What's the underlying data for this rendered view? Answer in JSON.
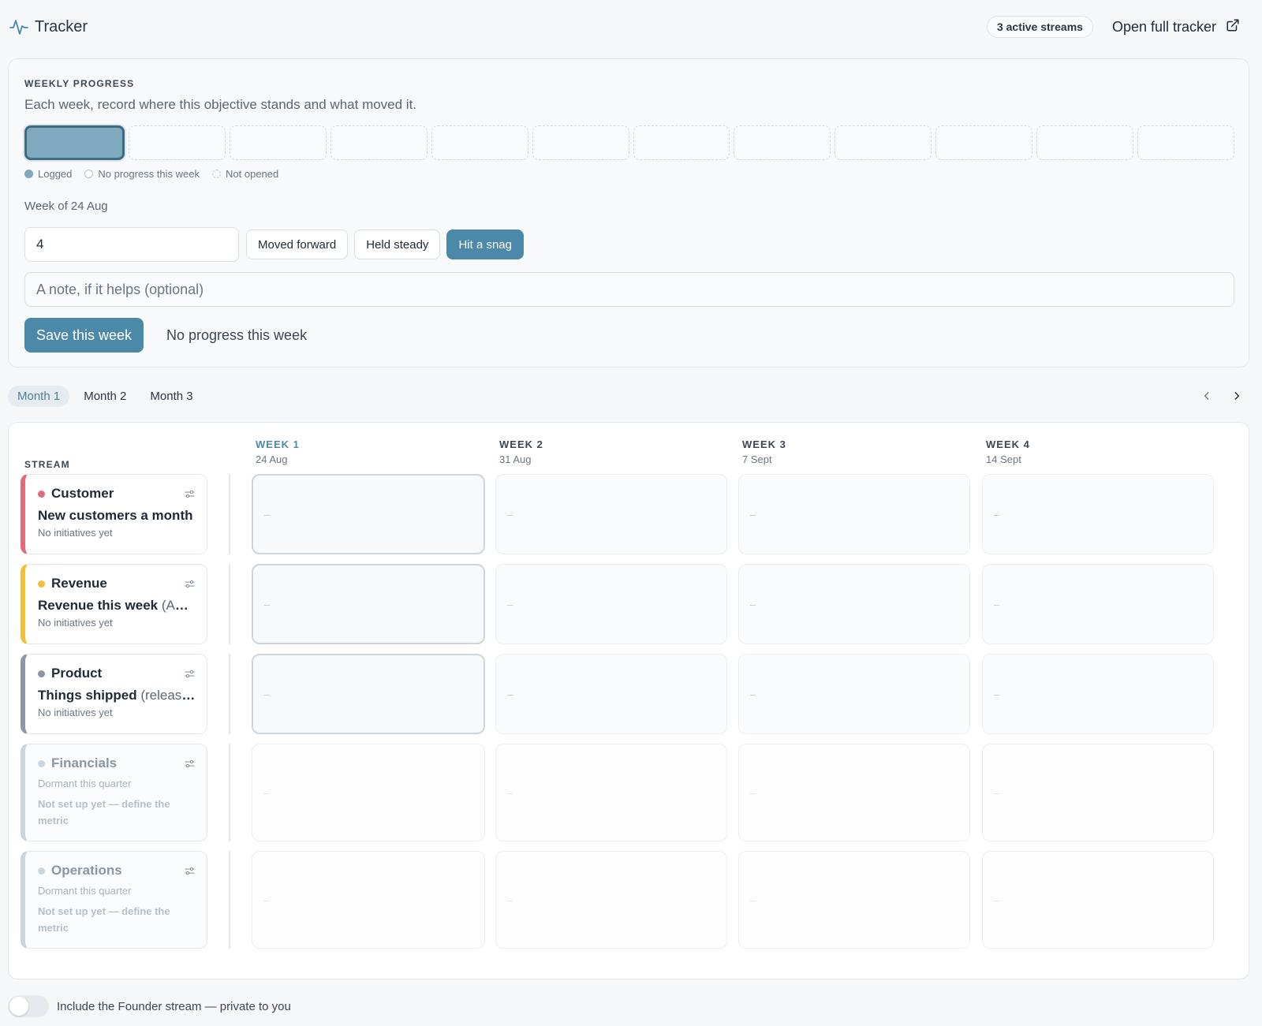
{
  "header": {
    "icon": "activity-pulse-icon",
    "title": "Tracker",
    "badge": "3 active streams",
    "open_label": "Open full tracker",
    "open_icon": "external-link-icon"
  },
  "progress": {
    "section_label": "WEEKLY PROGRESS",
    "description": "Each week, record where this objective stands and what moved it.",
    "week_states": [
      "logged",
      "not-opened",
      "not-opened",
      "not-opened",
      "not-opened",
      "not-opened",
      "not-opened",
      "not-opened",
      "not-opened",
      "not-opened",
      "not-opened",
      "not-opened"
    ],
    "legend": {
      "logged": "Logged",
      "no_progress": "No progress this week",
      "not_opened": "Not opened"
    },
    "week_of": "Week of 24 Aug",
    "value": "4",
    "status_options": [
      "Moved forward",
      "Held steady",
      "Hit a snag"
    ],
    "selected_status": "Hit a snag",
    "note_placeholder": "A note, if it helps (optional)",
    "save_label": "Save this week",
    "no_progress_label": "No progress this week",
    "accent_color": "#4c88a8"
  },
  "months": {
    "tabs": [
      "Month 1",
      "Month 2",
      "Month 3"
    ],
    "active": "Month 1"
  },
  "grid": {
    "stream_header": "STREAM",
    "weeks": [
      {
        "label": "WEEK 1",
        "date": "24 Aug",
        "current": true
      },
      {
        "label": "WEEK 2",
        "date": "31 Aug",
        "current": false
      },
      {
        "label": "WEEK 3",
        "date": "7 Sept",
        "current": false
      },
      {
        "label": "WEEK 4",
        "date": "14 Sept",
        "current": false
      }
    ],
    "empty_cell": "–",
    "streams": [
      {
        "name": "Customer",
        "color": "#e06b7d",
        "metric": "New customers a month",
        "unit": "",
        "sub": "No initiatives yet",
        "dormant": false
      },
      {
        "name": "Revenue",
        "color": "#f2bf3c",
        "metric": "Revenue this week",
        "unit": "(AUD)",
        "sub": "No initiatives yet",
        "dormant": false
      },
      {
        "name": "Product",
        "color": "#8d96a3",
        "metric": "Things shipped",
        "unit": "(releases)",
        "sub": "No initiatives yet",
        "dormant": false
      },
      {
        "name": "Financials",
        "color": "#c9d6de",
        "sub": "Dormant this quarter",
        "warn": "Not set up yet — define the metric",
        "dormant": true
      },
      {
        "name": "Operations",
        "color": "#c9d6de",
        "sub": "Dormant this quarter",
        "warn": "Not set up yet — define the metric",
        "dormant": true
      }
    ]
  },
  "footer": {
    "toggle_label": "Include the Founder stream — private to you",
    "toggle_on": false
  }
}
